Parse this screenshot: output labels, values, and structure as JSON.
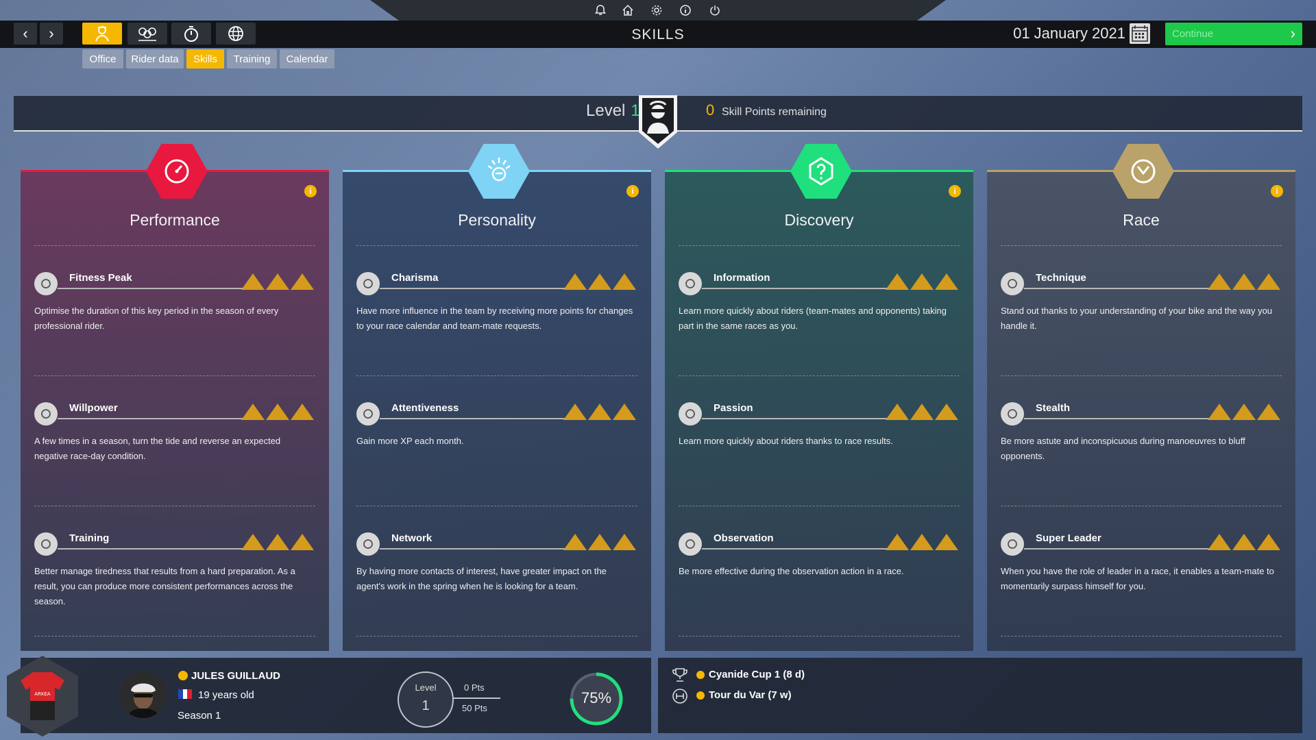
{
  "header": {
    "title": "SKILLS",
    "date": "01 January 2021",
    "continue_label": "Continue"
  },
  "subtabs": [
    {
      "label": "Office",
      "active": false
    },
    {
      "label": "Rider data",
      "active": false
    },
    {
      "label": "Skills",
      "active": true
    },
    {
      "label": "Training",
      "active": false
    },
    {
      "label": "Calendar",
      "active": false
    }
  ],
  "level_bar": {
    "level_label": "Level",
    "level_value": "1",
    "skill_points": "0",
    "skill_points_label": "Skill Points remaining"
  },
  "columns": [
    {
      "title": "Performance",
      "color": "#e8183f",
      "bg_top": "#6b3a5e",
      "icon": "speedometer-icon",
      "skills": [
        {
          "name": "Fitness Peak",
          "icon": "drop-icon",
          "desc": "Optimise the duration of this key period in the season of every professional rider."
        },
        {
          "name": "Willpower",
          "icon": "smile-icon",
          "desc": "A few times in a season, turn the tide and reverse an expected negative race-day condition."
        },
        {
          "name": "Training",
          "icon": "dumbbell-icon",
          "desc": "Better manage tiredness that results from a hard preparation. As a result, you can produce more consistent performances across the season."
        }
      ]
    },
    {
      "title": "Personality",
      "color": "#7fd3f5",
      "bg_top": "#354a6c",
      "icon": "crowd-icon",
      "skills": [
        {
          "name": "Charisma",
          "icon": "helmet-icon",
          "desc": "Have more influence in the team by receiving more points for changes to your race calendar and team-mate requests."
        },
        {
          "name": "Attentiveness",
          "icon": "ear-icon",
          "desc": "Gain more XP each month."
        },
        {
          "name": "Network",
          "icon": "cards-icon",
          "desc": "By having more contacts of interest, have greater impact on the agent's work in the spring when he is looking for a team."
        }
      ]
    },
    {
      "title": "Discovery",
      "color": "#1fe07c",
      "bg_top": "#2c5a5c",
      "icon": "question-icon",
      "skills": [
        {
          "name": "Information",
          "icon": "question-head-icon",
          "desc": "Learn more quickly about riders (team-mates and opponents) taking part in the same races as you."
        },
        {
          "name": "Passion",
          "icon": "jersey-icon",
          "desc": "Learn more quickly about riders thanks to race results."
        },
        {
          "name": "Observation",
          "icon": "speech-icon",
          "desc": "Be more effective during the observation action in a race."
        }
      ]
    },
    {
      "title": "Race",
      "color": "#b9a36a",
      "bg_top": "#4a5466",
      "icon": "wheel-icon",
      "skills": [
        {
          "name": "Technique",
          "icon": "bike-icon",
          "desc": "Stand out thanks to your understanding of your bike and the way you handle it."
        },
        {
          "name": "Stealth",
          "icon": "glasses-icon",
          "desc": "Be more astute and inconspicuous during manoeuvres to bluff opponents."
        },
        {
          "name": "Super Leader",
          "icon": "laurel-icon",
          "desc": "When you have the role of leader in a race, it enables a team-mate to momentarily surpass himself for you."
        }
      ]
    }
  ],
  "rider": {
    "name": "JULES GUILLAUD",
    "age": "19 years old",
    "season": "Season 1",
    "level_label": "Level",
    "level_value": "1",
    "pts_current": "0 Pts",
    "pts_next": "50 Pts",
    "condition": "75%",
    "condition_fraction": 0.75,
    "jersey_text": "ARKEA"
  },
  "races": [
    {
      "name": "Cyanide Cup 1 (8 d)",
      "icon": "trophy-icon"
    },
    {
      "name": "Tour du Var (7 w)",
      "icon": "stage-icon"
    }
  ]
}
